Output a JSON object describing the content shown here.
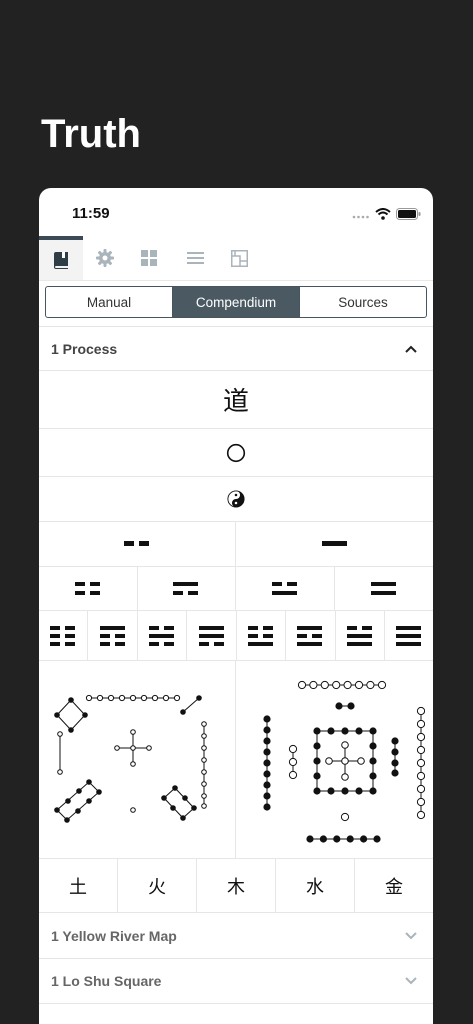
{
  "app": {
    "title": "Truth"
  },
  "status_bar": {
    "time": "11:59"
  },
  "tab_icons": [
    "book-icon",
    "gear-icon",
    "grid-icon",
    "list-icon",
    "layout-icon"
  ],
  "segments": {
    "manual": "Manual",
    "compendium": "Compendium",
    "sources": "Sources",
    "selected": "Compendium"
  },
  "sections": {
    "process": {
      "title": "1 Process",
      "expanded": true
    },
    "yellow_river": {
      "title": "1 Yellow River Map",
      "expanded": false
    },
    "lo_shu": {
      "title": "1 Lo Shu Square",
      "expanded": false
    }
  },
  "process": {
    "dao": "道",
    "wuji": "○",
    "taiji": "☯",
    "elements": [
      "土",
      "火",
      "木",
      "水",
      "金"
    ]
  }
}
